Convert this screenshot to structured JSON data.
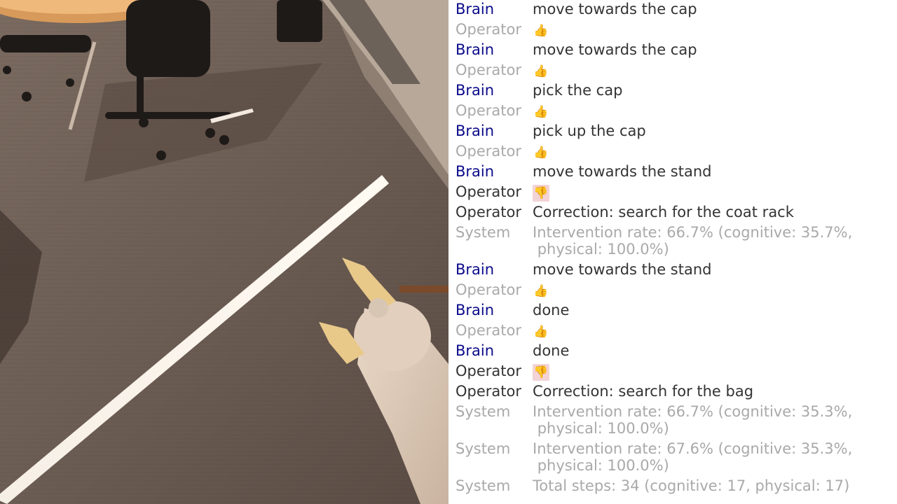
{
  "log": {
    "entries": [
      {
        "speaker": "Brain",
        "type": "text",
        "text": "move towards the cap"
      },
      {
        "speaker": "Operator",
        "type": "thumb_up"
      },
      {
        "speaker": "Brain",
        "type": "text",
        "text": "move towards the cap"
      },
      {
        "speaker": "Operator",
        "type": "thumb_up"
      },
      {
        "speaker": "Brain",
        "type": "text",
        "text": "pick the cap"
      },
      {
        "speaker": "Operator",
        "type": "thumb_up"
      },
      {
        "speaker": "Brain",
        "type": "text",
        "text": "pick up the cap"
      },
      {
        "speaker": "Operator",
        "type": "thumb_up"
      },
      {
        "speaker": "Brain",
        "type": "text",
        "text": "move towards the stand"
      },
      {
        "speaker": "Operator",
        "type": "thumb_down"
      },
      {
        "speaker": "Operator",
        "type": "correction",
        "text": "Correction: search for the coat rack"
      },
      {
        "speaker": "System",
        "type": "system",
        "text": "Intervention rate: 66.7% (cognitive: 35.7%,\n physical: 100.0%)"
      },
      {
        "speaker": "Brain",
        "type": "text",
        "text": "move towards the stand"
      },
      {
        "speaker": "Operator",
        "type": "thumb_up"
      },
      {
        "speaker": "Brain",
        "type": "text",
        "text": "done"
      },
      {
        "speaker": "Operator",
        "type": "thumb_up"
      },
      {
        "speaker": "Brain",
        "type": "text",
        "text": "done"
      },
      {
        "speaker": "Operator",
        "type": "thumb_down"
      },
      {
        "speaker": "Operator",
        "type": "correction",
        "text": "Correction: search for the bag"
      },
      {
        "speaker": "System",
        "type": "system",
        "text": "Intervention rate: 66.7% (cognitive: 35.3%,\n physical: 100.0%)"
      },
      {
        "speaker": "System",
        "type": "system",
        "text": "Intervention rate: 67.6% (cognitive: 35.3%,\n physical: 100.0%)"
      },
      {
        "speaker": "System",
        "type": "system",
        "text": "Total steps: 34 (cognitive: 17, physical: 17)"
      }
    ]
  },
  "icons": {
    "thumb_up": "thumbs-up-icon",
    "thumb_down": "thumbs-down-icon"
  },
  "colors": {
    "brain": "#0a0a8a",
    "operator": "#333333",
    "muted": "#a9a9a9",
    "thumb_down_bg": "#f3d3d6"
  }
}
